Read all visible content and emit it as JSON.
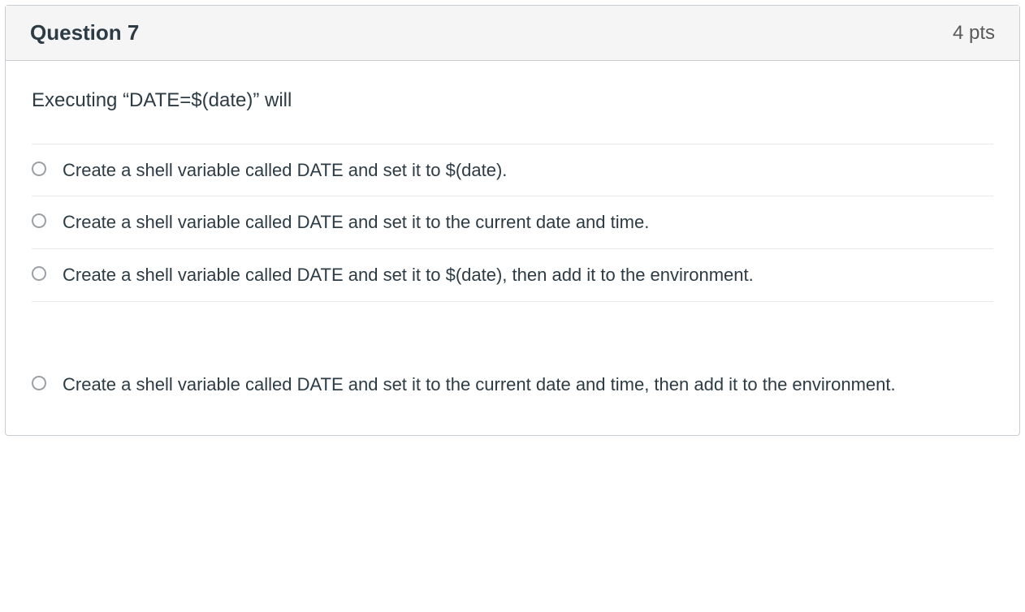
{
  "question": {
    "title": "Question 7",
    "points": "4 pts",
    "prompt": "Executing “DATE=$(date)” will",
    "options": [
      {
        "label": "Create a shell variable called DATE and set it to $(date)."
      },
      {
        "label": "Create a shell variable called DATE and set it to the current date and time."
      },
      {
        "label": "Create a shell variable called DATE and set it to $(date), then add it to the environment."
      },
      {
        "label": "Create a shell variable called DATE and set it to the current date and time, then add it to the environment."
      }
    ]
  }
}
